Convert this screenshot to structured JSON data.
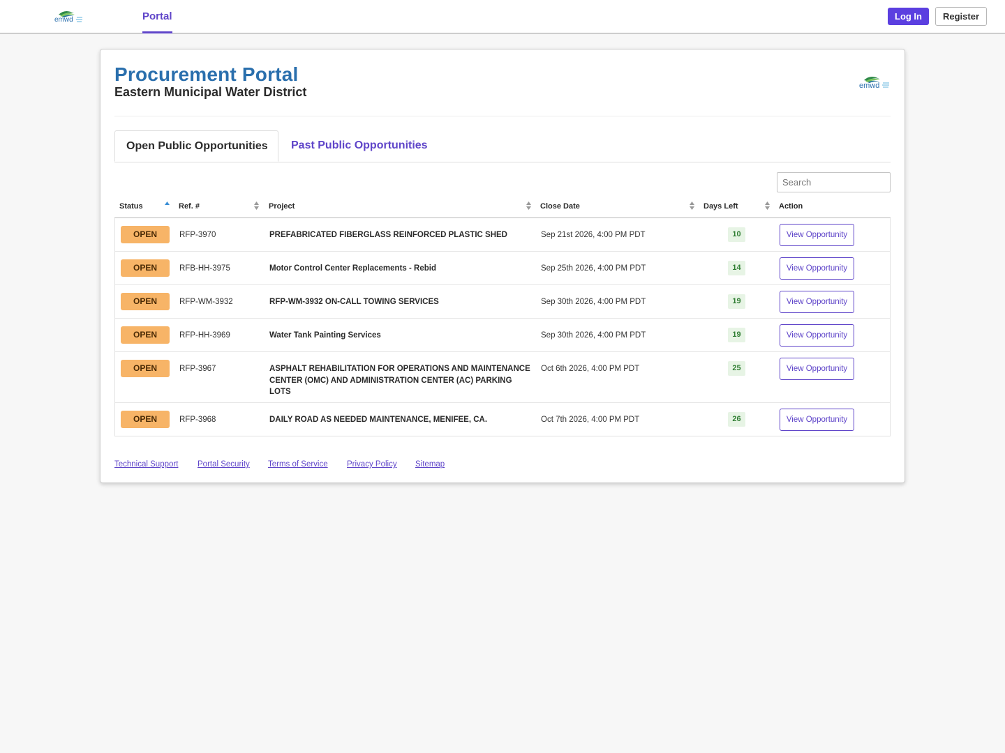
{
  "nav": {
    "logo_text": "emwd",
    "portal_label": "Portal",
    "login_label": "Log In",
    "register_label": "Register"
  },
  "header": {
    "title": "Procurement Portal",
    "subtitle": "Eastern Municipal Water District",
    "logo_text": "emwd"
  },
  "tabs": [
    {
      "label": "Open Public Opportunities",
      "active": true
    },
    {
      "label": "Past Public Opportunities",
      "active": false
    }
  ],
  "search": {
    "placeholder": "Search",
    "value": ""
  },
  "table": {
    "columns": [
      "Status",
      "Ref. #",
      "Project",
      "Close Date",
      "Days Left",
      "Action"
    ],
    "sorted_column": "Status",
    "sort_direction": "ascending",
    "rows": [
      {
        "status": "OPEN",
        "ref": "RFP-3970",
        "project": "PREFABRICATED FIBERGLASS REINFORCED PLASTIC SHED",
        "close_date": "Sep 21st 2026, 4:00 PM PDT",
        "days_left": "10",
        "action": "View Opportunity"
      },
      {
        "status": "OPEN",
        "ref": "RFB-HH-3975",
        "project": "Motor Control Center Replacements - Rebid",
        "close_date": "Sep 25th 2026, 4:00 PM PDT",
        "days_left": "14",
        "action": "View Opportunity"
      },
      {
        "status": "OPEN",
        "ref": "RFP-WM-3932",
        "project": "RFP-WM-3932 ON-CALL TOWING SERVICES",
        "close_date": "Sep 30th 2026, 4:00 PM PDT",
        "days_left": "19",
        "action": "View Opportunity"
      },
      {
        "status": "OPEN",
        "ref": "RFP-HH-3969",
        "project": "Water Tank Painting Services",
        "close_date": "Sep 30th 2026, 4:00 PM PDT",
        "days_left": "19",
        "action": "View Opportunity"
      },
      {
        "status": "OPEN",
        "ref": "RFP-3967",
        "project": "ASPHALT REHABILITATION FOR OPERATIONS AND MAINTENANCE CENTER (OMC) AND ADMINISTRATION CENTER (AC) PARKING LOTS",
        "close_date": "Oct 6th 2026, 4:00 PM PDT",
        "days_left": "25",
        "action": "View Opportunity"
      },
      {
        "status": "OPEN",
        "ref": "RFP-3968",
        "project": "DAILY ROAD AS NEEDED MAINTENANCE, MENIFEE, CA.",
        "close_date": "Oct 7th 2026, 4:00 PM PDT",
        "days_left": "26",
        "action": "View Opportunity"
      }
    ]
  },
  "footer": {
    "links": [
      "Technical Support",
      "Portal Security",
      "Terms of Service",
      "Privacy Policy",
      "Sitemap"
    ]
  },
  "colors": {
    "accent": "#5f45c9",
    "login_button": "#5b3fe0",
    "title": "#2a6fad",
    "status_open": "#f7b467",
    "days_left_bg": "#e7f4e5",
    "days_left_text": "#2f7d32",
    "page_bg": "#f7f7f7"
  },
  "icons": {
    "logo": "emwd-logo",
    "sort_active": "sort-ascending-icon",
    "sort_inactive": "sort-both-icon"
  }
}
